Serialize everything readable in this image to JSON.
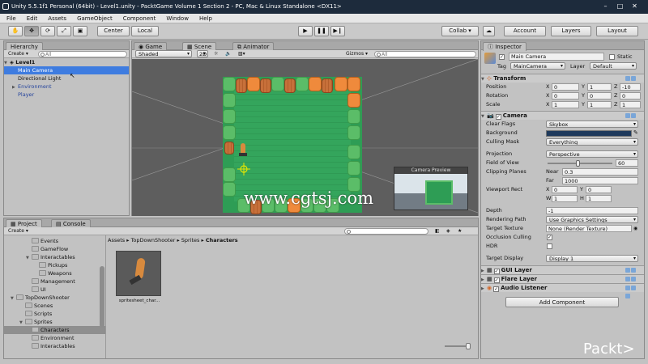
{
  "window": {
    "title": "Unity 5.5.1f1 Personal (64bit) - Level1.unity - PacktGame Volume 1 Section 2 - PC, Mac & Linux Standalone <DX11>"
  },
  "menu": [
    "File",
    "Edit",
    "Assets",
    "GameObject",
    "Component",
    "Window",
    "Help"
  ],
  "toolbar": {
    "center": "Center",
    "local": "Local",
    "collab": "Collab ▾",
    "account": "Account",
    "layers": "Layers",
    "layout": "Layout"
  },
  "hierarchy": {
    "tab": "Hierarchy",
    "create": "Create ▾",
    "search_placeholder": "All",
    "scene": "Level1",
    "items": [
      "Main Camera",
      "Directional Light",
      "Environment",
      "Player"
    ]
  },
  "scene_tabs": {
    "game": "Game",
    "scene": "Scene",
    "animator": "Animator"
  },
  "scene_bar": {
    "shaded": "Shaded",
    "two_d": "2D",
    "gizmos": "Gizmos ▾",
    "search_placeholder": "All"
  },
  "camera_preview": {
    "title": "Camera Preview"
  },
  "watermark": "www.cgtsj.com",
  "project": {
    "tab_project": "Project",
    "tab_console": "Console",
    "create": "Create ▾",
    "tree": [
      {
        "label": "Events",
        "indent": 2
      },
      {
        "label": "GameFlow",
        "indent": 2
      },
      {
        "label": "Interactables",
        "indent": 2
      },
      {
        "label": "Pickups",
        "indent": 3
      },
      {
        "label": "Weapons",
        "indent": 3
      },
      {
        "label": "Management",
        "indent": 2
      },
      {
        "label": "UI",
        "indent": 2
      },
      {
        "label": "TopDownShooter",
        "indent": 0
      },
      {
        "label": "Scenes",
        "indent": 1
      },
      {
        "label": "Scripts",
        "indent": 1
      },
      {
        "label": "Sprites",
        "indent": 1
      },
      {
        "label": "Characters",
        "indent": 2
      },
      {
        "label": "Environment",
        "indent": 2
      },
      {
        "label": "Interactables",
        "indent": 2
      }
    ],
    "breadcrumb": [
      "Assets",
      "TopDownShooter",
      "Sprites",
      "Characters"
    ],
    "asset_name": "spritesheet_char..."
  },
  "inspector": {
    "tab": "Inspector",
    "object_name": "Main Camera",
    "static": "Static",
    "tag_label": "Tag",
    "tag_value": "MainCamera",
    "layer_label": "Layer",
    "layer_value": "Default",
    "transform": {
      "title": "Transform",
      "position": [
        "0",
        "1",
        "-10"
      ],
      "rotation": [
        "0",
        "0",
        "0"
      ],
      "scale": [
        "1",
        "1",
        "1"
      ],
      "labels": [
        "Position",
        "Rotation",
        "Scale"
      ]
    },
    "camera": {
      "title": "Camera",
      "clear_flags": "Skybox",
      "culling_mask": "Everything",
      "projection": "Perspective",
      "fov": "60",
      "fov_level": 0.47,
      "near": "0.3",
      "far": "1000",
      "viewport": {
        "x": "0",
        "y": "0",
        "w": "1",
        "h": "1"
      },
      "depth": "-1",
      "rendering_path": "Use Graphics Settings",
      "target_texture": "None (Render Texture)",
      "target_display": "Display 1",
      "labels": {
        "clear_flags": "Clear Flags",
        "background": "Background",
        "culling_mask": "Culling Mask",
        "projection": "Projection",
        "fov": "Field of View",
        "clipping": "Clipping Planes",
        "near": "Near",
        "far": "Far",
        "viewport": "Viewport Rect",
        "depth": "Depth",
        "rendering_path": "Rendering Path",
        "target_texture": "Target Texture",
        "occlusion": "Occlusion Culling",
        "hdr": "HDR",
        "target_display": "Target Display"
      }
    },
    "components": [
      "GUI Layer",
      "Flare Layer",
      "Audio Listener"
    ],
    "add_component": "Add Component"
  },
  "logo": "Packt>",
  "colors": {
    "selection": "#3e7ce0",
    "background_swatch": "#1f3a5c",
    "titlebar": "#1d2b3c"
  }
}
